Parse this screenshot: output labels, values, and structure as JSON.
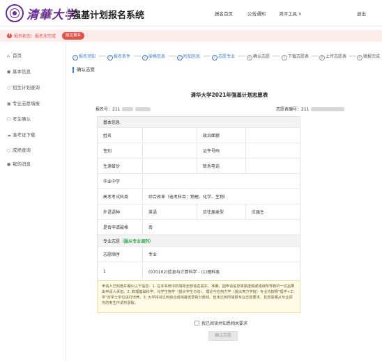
{
  "header": {
    "logo_text": "清華大学",
    "app_title": "强基计划报名系统",
    "nav": {
      "home": "报名首页",
      "notice": "公告通知",
      "tools": "测评工具 ∨",
      "logout": "退出"
    }
  },
  "status": {
    "text": "报名状态：报名未完成",
    "button": "前往报名",
    "icon": "alert-icon"
  },
  "sidebar": {
    "items": [
      {
        "label": "首页",
        "icon": "home-icon",
        "glyph": "⌂"
      },
      {
        "label": "基本信息",
        "icon": "user-icon",
        "glyph": "●"
      },
      {
        "label": "招生计划查询",
        "icon": "search-icon",
        "glyph": "○"
      },
      {
        "label": "专业志愿填报",
        "icon": "edit-icon",
        "glyph": "▣"
      },
      {
        "label": "考生确认",
        "icon": "confirm-icon",
        "glyph": "☐"
      },
      {
        "label": "准考证下载",
        "icon": "download-icon",
        "glyph": "☁"
      },
      {
        "label": "成绩查询",
        "icon": "search-icon",
        "glyph": "○"
      },
      {
        "label": "我的消息",
        "icon": "bell-icon",
        "glyph": "●"
      }
    ]
  },
  "steps": [
    {
      "num": "✓",
      "label": "报名须知",
      "state": "done"
    },
    {
      "num": "✓",
      "label": "报名条件",
      "state": "done"
    },
    {
      "num": "✓",
      "label": "破格信息",
      "state": "done"
    },
    {
      "num": "✓",
      "label": "附加信息",
      "state": "done"
    },
    {
      "num": "✓",
      "label": "志愿专业",
      "state": "done"
    },
    {
      "num": "6",
      "label": "确认志愿",
      "state": "pending"
    },
    {
      "num": "7",
      "label": "下载志愿表",
      "state": "pending"
    },
    {
      "num": "8",
      "label": "上传志愿表",
      "state": "pending"
    },
    {
      "num": "9",
      "label": "填报完成",
      "state": "pending"
    }
  ],
  "section_title": "确认志愿",
  "form": {
    "title": "清华大学2021年强基计划志愿表",
    "reg_label": "报名号：211",
    "vol_label": "志愿表编号：211",
    "basic_header": "基本信息",
    "name_label": "姓名",
    "politics_label": "政治面貌",
    "gender_label": "性别",
    "id_label": "证件号码",
    "origin_label": "生源省份",
    "phone_label": "联系电话",
    "school_label": "毕业中学",
    "subjects_label": "高考考试科类",
    "subjects_value": "综合改革（选考科目：物理、化学、生物）",
    "lang_label": "外语语种",
    "lang_value": "英语",
    "grad_type_label": "应往届类型",
    "grad_type_value": "应届生",
    "exception_label": "是否申请破格",
    "exception_value": "否",
    "major_header": "专业志愿",
    "major_header_note": "（服从专业调剂）",
    "order_col": "志愿顺序",
    "major_col": "专业",
    "order_value": "1",
    "major_value": "(070102)信息与计算科学 - (1)理科类"
  },
  "note": "申请人已知悉并确认以下信息：1. 在本系统中所填报全部信息真实、准确，因申请信息填报虚假或错误所导致的一切后果由申请人承担。2. 数理基础科学、化学生物学（拔尖学生方向）、理论与应用力学（拔尖育力学班）专业均按照\"理学+工学\"双学士学位进行培养。3. 大学将对达到综合成绩最低录取分数线、但未达到所填报专业志愿要求、且愿意服从专业调剂的考生作调剂录取。",
  "agree_label": "我已阅读并知悉相关要求",
  "confirm_button": "确认志愿"
}
